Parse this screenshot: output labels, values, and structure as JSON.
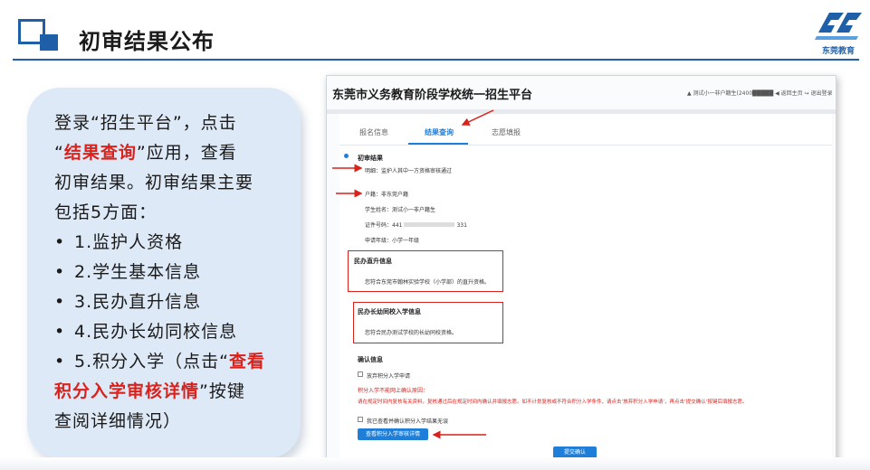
{
  "slide": {
    "title": "初审结果公布",
    "brand_text": "东莞教育"
  },
  "bubble": {
    "line1": "登录“招生平台”，点击",
    "line2_pre": "“",
    "line2_red": "结果查询",
    "line2_post": "”应用，查看",
    "line3": "初审结果。初审结果主要",
    "line4": "包括5方面：",
    "bullets": [
      "1.监护人资格",
      "2.学生基本信息",
      "3.民办直升信息",
      "4.民办长幼同校信息"
    ],
    "b5_pre": "5.积分入学（点击“",
    "b5_red1": "查看",
    "b5_red2": "积分入学审核详情",
    "b5_post": "”按键",
    "b5_last": "查阅详细情况）",
    "bullet_symbol": "•"
  },
  "panel": {
    "title": "东莞市义务教育阶段学校统一招生平台",
    "user_links": "▲ 测试小一非户籍生(2400█████  ◀ 返回主页  ↪ 退出登录",
    "tabs": [
      "报名信息",
      "结果查询",
      "志愿填报"
    ],
    "section_title": "初审结果",
    "guardian": "明细：监护人其中一方资格审核通过",
    "huji": "户籍：非东莞户籍",
    "student_name": "学生姓名：测试小一非户籍生",
    "id_label": "证件号码：441",
    "id_tail": "331",
    "grade": "申请年级：小学一年级",
    "minban_title": "民办直升信息",
    "minban_text": "您符合东莞市翰林实验学校（小学部）的直升资格。",
    "zhangyou_title": "民办长幼同校入学信息",
    "zhangyou_text": "您符合民办测试学校的长幼同校资格。",
    "confirm_title": "确认信息",
    "giveup_label": "放弃积分入学申请",
    "reason_title": "积分入学不能网上确认原因：",
    "reason_text": "请在规定时间内复核有关资料，复核通过后在规定时间内确认并填报志愿。如不计划复核或不符合积分入学条件，请点击‘放弃积分入学申请’，再点击‘提交确认’按键后填报志愿。",
    "checked_label": "我已查看并确认积分入学结果无误",
    "detail_button": "查看积分入学审核详情",
    "submit_button": "提交确认"
  },
  "colors": {
    "brand_blue": "#1f5fa8",
    "accent_red": "#d9221c",
    "link_blue": "#1f7fd8",
    "bubble_bg": "#dde9f7"
  }
}
